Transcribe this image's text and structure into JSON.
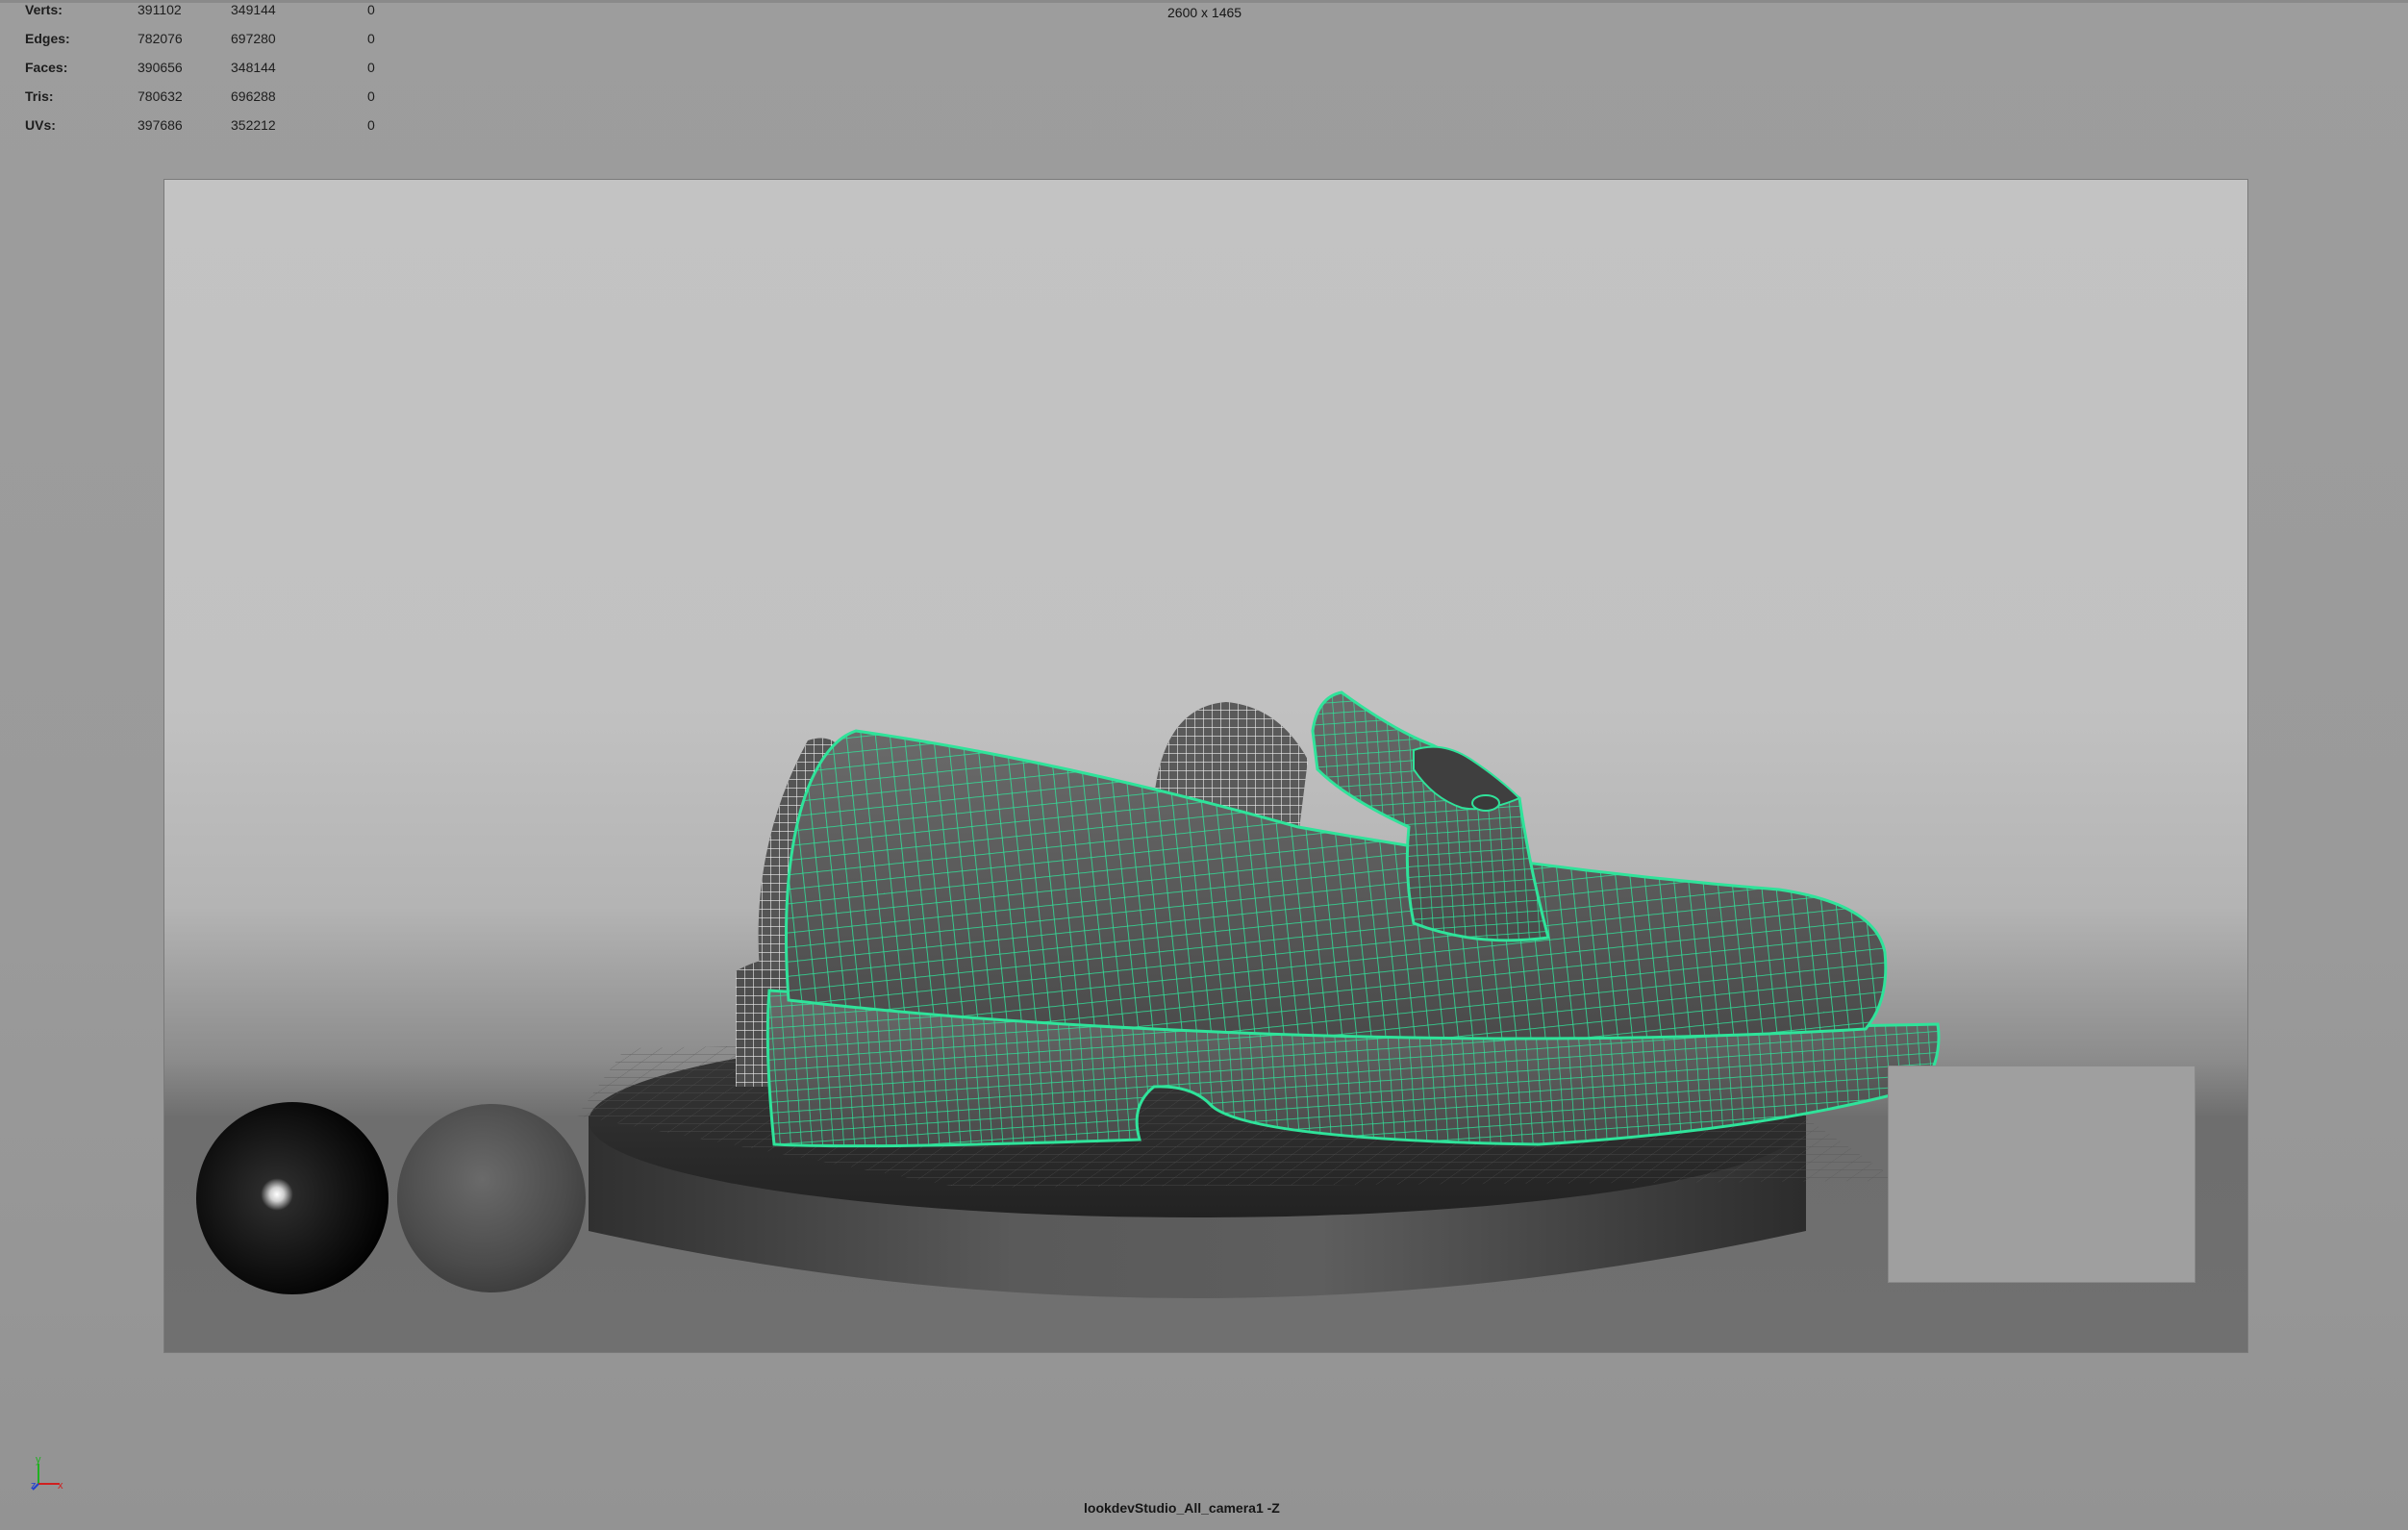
{
  "viewport": {
    "resolution_label": "2600 x 1465",
    "camera_label": "lookdevStudio_All_camera1 -Z"
  },
  "hud": {
    "rows": [
      {
        "label": "Verts:",
        "v1": "391102",
        "v2": "349144",
        "v3": "0"
      },
      {
        "label": "Edges:",
        "v1": "782076",
        "v2": "697280",
        "v3": "0"
      },
      {
        "label": "Faces:",
        "v1": "390656",
        "v2": "348144",
        "v3": "0"
      },
      {
        "label": "Tris:",
        "v1": "780632",
        "v2": "696288",
        "v3": "0"
      },
      {
        "label": "UVs:",
        "v1": "397686",
        "v2": "352212",
        "v3": "0"
      }
    ]
  },
  "gizmo": {
    "y_label": "y",
    "z_label": "z",
    "x_label": "x"
  },
  "colors": {
    "wireframe_selected": "#2fe39a",
    "shoe_shading": "#5f5f5f",
    "wireframe_unselected": "#e8e8e8",
    "axis_x": "#d02020",
    "axis_y": "#20b020",
    "axis_z": "#2040d0"
  },
  "icons": [
    "axis-gizmo-icon"
  ]
}
